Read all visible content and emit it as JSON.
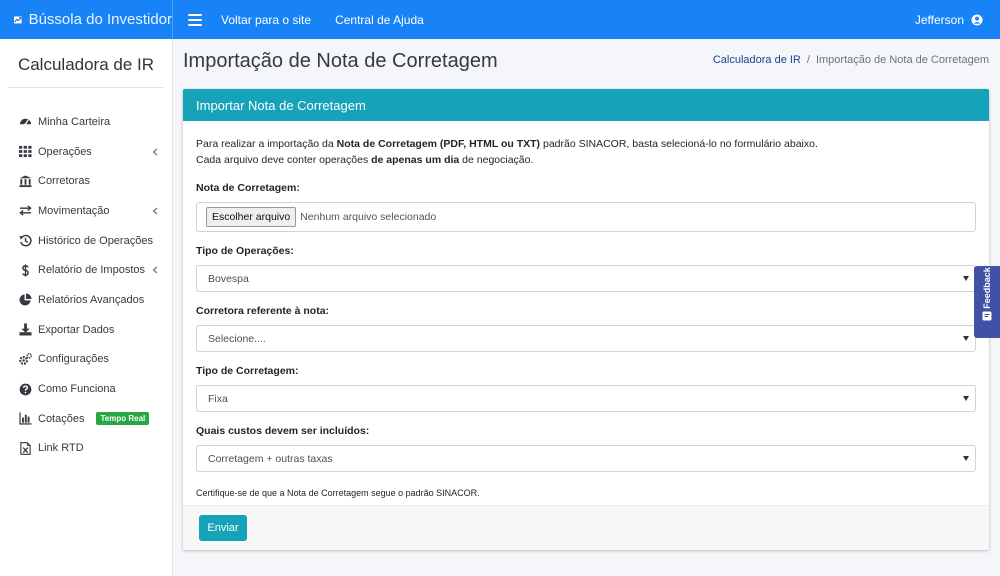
{
  "brand": {
    "name": "Bússola do Investidor",
    "icon": "chart-line-logo-icon"
  },
  "topnav": {
    "links": [
      "Voltar para o site",
      "Central de Ajuda"
    ],
    "user": "Jefferson"
  },
  "sidebar": {
    "title": "Calculadora de IR",
    "items": [
      {
        "label": "Minha Carteira",
        "icon": "dashboard-icon",
        "has_submenu": false
      },
      {
        "label": "Operações",
        "icon": "grid-icon",
        "has_submenu": true
      },
      {
        "label": "Corretoras",
        "icon": "bank-icon",
        "has_submenu": false
      },
      {
        "label": "Movimentação",
        "icon": "exchange-icon",
        "has_submenu": true
      },
      {
        "label": "Histórico de Operações",
        "icon": "history-icon",
        "has_submenu": false
      },
      {
        "label": "Relatório de Impostos",
        "icon": "dollar-icon",
        "has_submenu": true
      },
      {
        "label": "Relatórios Avançados",
        "icon": "pie-chart-icon",
        "has_submenu": false
      },
      {
        "label": "Exportar Dados",
        "icon": "download-icon",
        "has_submenu": false
      },
      {
        "label": "Configurações",
        "icon": "cogs-icon",
        "has_submenu": false
      },
      {
        "label": "Como Funciona",
        "icon": "question-circle-icon",
        "has_submenu": false
      },
      {
        "label": "Cotações",
        "icon": "bar-chart-icon",
        "has_submenu": false,
        "badge": "Tempo Real"
      },
      {
        "label": "Link RTD",
        "icon": "excel-file-icon",
        "has_submenu": false
      }
    ]
  },
  "header": {
    "title": "Importação de Nota de Corretagem",
    "breadcrumb": {
      "link": "Calculadora de IR",
      "current": "Importação de Nota de Corretagem"
    }
  },
  "card": {
    "title": "Importar Nota de Corretagem",
    "intro": {
      "line1_a": "Para realizar a importação da ",
      "line1_b": "Nota de Corretagem (PDF, HTML ou TXT)",
      "line1_c": " padrão SINACOR, basta selecioná-lo no formulário abaixo.",
      "line2_a": "Cada arquivo deve conter operações ",
      "line2_b": "de apenas um dia",
      "line2_c": " de negociação."
    },
    "file_field": {
      "label": "Nota de Corretagem:",
      "button": "Escolher arquivo",
      "status": "Nenhum arquivo selecionado"
    },
    "tipo_operacoes": {
      "label": "Tipo de Operações:",
      "value": "Bovespa"
    },
    "corretora": {
      "label": "Corretora referente à nota:",
      "value": "Selecione...."
    },
    "tipo_corretagem": {
      "label": "Tipo de Corretagem:",
      "value": "Fixa"
    },
    "custos": {
      "label": "Quais custos devem ser incluídos:",
      "value": "Corretagem + outras taxas"
    },
    "note": "Certifique-se de que a Nota de Corretagem segue o padrão SINACOR.",
    "submit": "Enviar"
  },
  "feedback": {
    "label": "Feedback"
  },
  "colors": {
    "primary": "#1783f7",
    "info": "#16a2b8",
    "success": "#28a745",
    "feedback": "#4251a5"
  }
}
